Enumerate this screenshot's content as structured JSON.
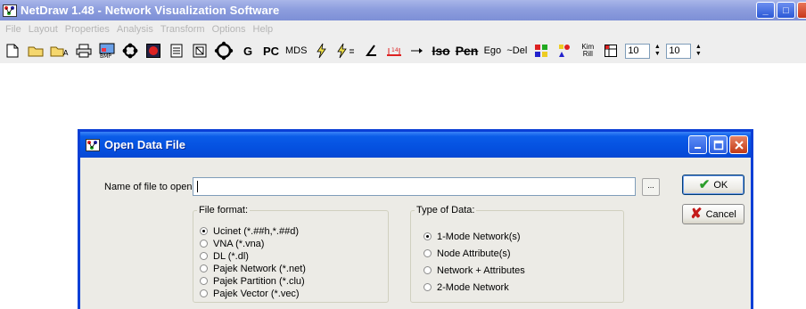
{
  "app": {
    "title": "NetDraw 1.48 - Network Visualization Software",
    "window_buttons": {
      "minimize": "_",
      "maximize": "□"
    }
  },
  "menu": {
    "items": [
      "File",
      "Layout",
      "Properties",
      "Analysis",
      "Transform",
      "Options",
      "Help"
    ],
    "state": "disabled"
  },
  "toolbar": {
    "text_buttons": {
      "g": "G",
      "pc": "PC",
      "mds": "MDS",
      "iso": "Iso",
      "pen": "Pen",
      "ego": "Ego",
      "del": "~Del",
      "kim": "Kim",
      "rill": "Rill"
    },
    "spinner1_value": "10",
    "spinner2_value": "10"
  },
  "dialog": {
    "title": "Open Data File",
    "file_label": "Name of file to open:",
    "file_value": "",
    "browse_label": "...",
    "ok_label": "OK",
    "cancel_label": "Cancel",
    "file_format": {
      "legend": "File format:",
      "options": [
        "Ucinet (*.##h,*.##d)",
        "VNA (*.vna)",
        "DL (*.dl)",
        "Pajek Network (*.net)",
        "Pajek Partition (*.clu)",
        "Pajek Vector (*.vec)"
      ],
      "selected": 0
    },
    "data_type": {
      "legend": "Type of Data:",
      "options": [
        "1-Mode Network(s)",
        "Node Attribute(s)",
        "Network + Attributes",
        "2-Mode Network"
      ],
      "selected": 0
    }
  },
  "colors": {
    "app_titlebar": "#8d9ede",
    "dialog_titlebar": "#0551e0",
    "dialog_body": "#ecebe6",
    "ok_check": "#2a9d2a",
    "cancel_x": "#c41a1a"
  }
}
